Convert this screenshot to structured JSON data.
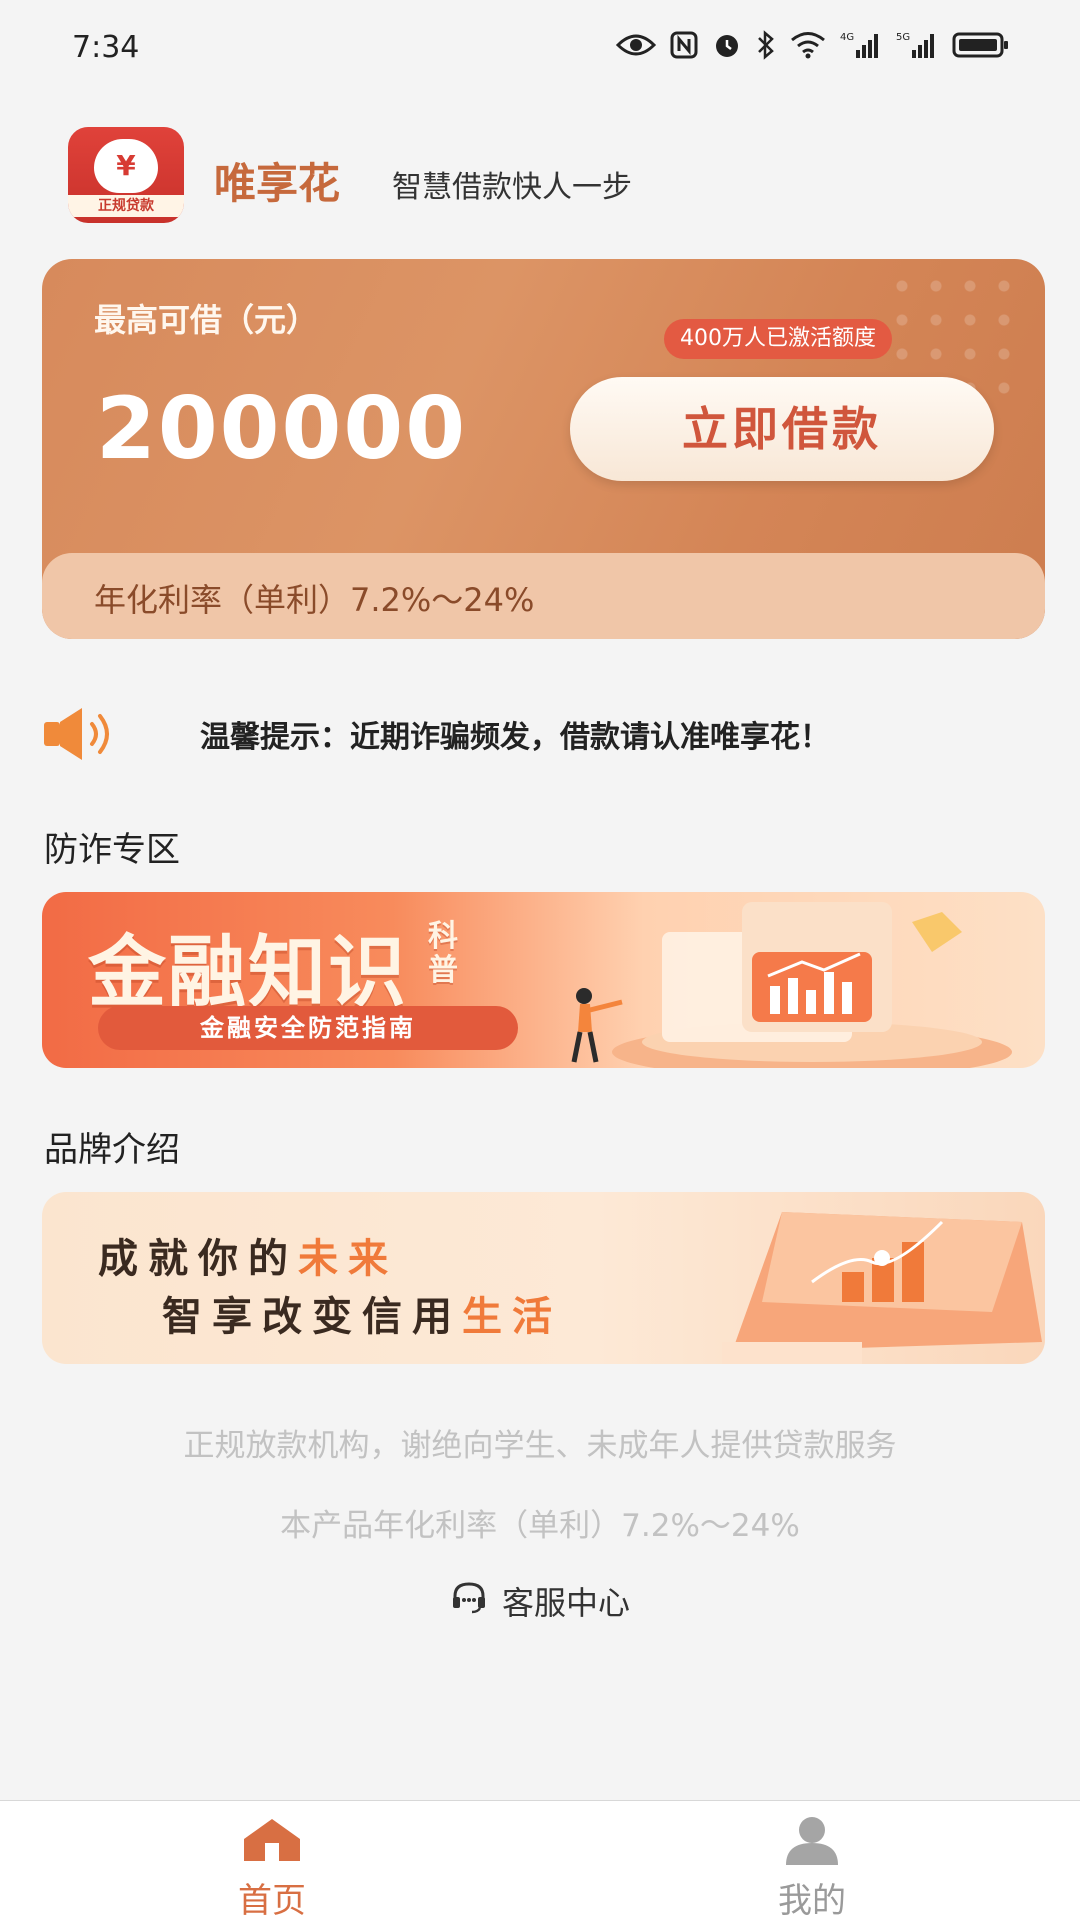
{
  "status_bar": {
    "time": "7:34",
    "icons": [
      "eye-icon",
      "nfc-icon",
      "alarm-icon",
      "bluetooth-icon",
      "wifi-icon",
      "signal-4g-icon",
      "signal-5g-icon",
      "battery-icon"
    ],
    "network_4g": "4G",
    "network_5g": "5G"
  },
  "header": {
    "logo_symbol": "¥",
    "logo_band": "正规贷款",
    "app_name": "唯享花",
    "slogan": "智慧借款快人一步"
  },
  "loan_card": {
    "max_label": "最高可借（元）",
    "amount": "200000",
    "activation_badge": "400万人已激活额度",
    "borrow_button": "立即借款",
    "rate_text": "年化利率（单利）7.2%～24%"
  },
  "notice": {
    "icon": "speaker-icon",
    "text": "温馨提示：近期诈骗频发，借款请认准唯享花！"
  },
  "fraud_section": {
    "title": "防诈专区",
    "banner_title": "金融知识",
    "banner_title_small": "科普",
    "banner_subtitle": "金融安全防范指南"
  },
  "brand_section": {
    "title": "品牌介绍",
    "line1_prefix": "成就你的",
    "line1_highlight": "未来",
    "line2_prefix": "智享改变信用",
    "line2_highlight": "生活"
  },
  "footer": {
    "disclaimer1": "正规放款机构，谢绝向学生、未成年人提供贷款服务",
    "disclaimer2": "本产品年化利率（单利）7.2%～24%",
    "service_label": "客服中心"
  },
  "tab_bar": {
    "tabs": [
      {
        "label": "首页",
        "icon": "home-icon",
        "active": true
      },
      {
        "label": "我的",
        "icon": "user-icon",
        "active": false
      }
    ]
  },
  "colors": {
    "accent": "#d86f43",
    "card": "#d78a5c",
    "badge": "#e35a42",
    "highlight": "#f07a3a"
  }
}
